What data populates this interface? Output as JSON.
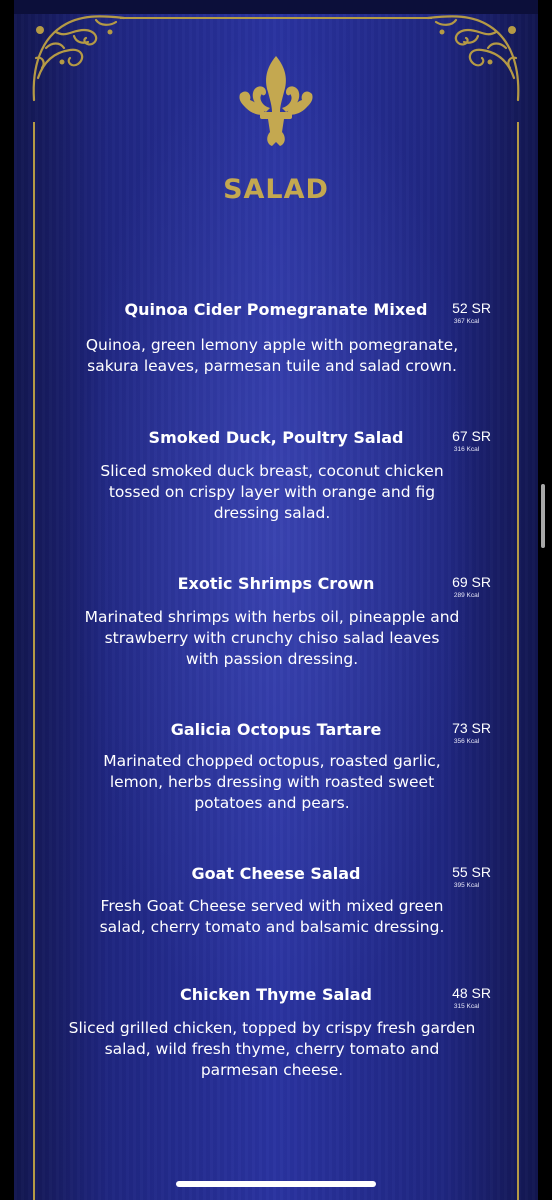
{
  "menu": {
    "section_title": "SALAD",
    "items": [
      {
        "name": "Quinoa Cider Pomegranate Mixed",
        "price": "52 SR",
        "kcal": "367 Kcal",
        "description": "Quinoa, green lemony apple with pomegranate,\nsakura leaves, parmesan tuile and salad crown."
      },
      {
        "name": "Smoked Duck, Poultry Salad",
        "price": "67 SR",
        "kcal": "316 Kcal",
        "description": "Sliced smoked duck breast, coconut chicken\ntossed on crispy layer with orange and fig\ndressing salad."
      },
      {
        "name": "Exotic Shrimps Crown",
        "price": "69 SR",
        "kcal": "289 Kcal",
        "description": "Marinated shrimps with herbs oil, pineapple and\nstrawberry with crunchy chiso salad leaves\nwith passion dressing."
      },
      {
        "name": "Galicia Octopus Tartare",
        "price": "73 SR",
        "kcal": "356 Kcal",
        "description": "Marinated chopped octopus, roasted garlic,\nlemon, herbs dressing with roasted sweet\npotatoes and pears."
      },
      {
        "name": "Goat Cheese Salad",
        "price": "55 SR",
        "kcal": "395 Kcal",
        "description": "Fresh Goat Cheese served with mixed green\nsalad, cherry tomato and balsamic dressing."
      },
      {
        "name": "Chicken Thyme Salad",
        "price": "48 SR",
        "kcal": "315 Kcal",
        "description": "Sliced grilled chicken, topped by crispy fresh garden\nsalad, wild fresh thyme, cherry tomato and\nparmesan cheese."
      }
    ]
  },
  "icons": {
    "emblem": "fleur-de-lis-icon",
    "corners": "ornament-icon"
  },
  "colors": {
    "gold": "#c4a850",
    "background": "#2a33a0"
  }
}
